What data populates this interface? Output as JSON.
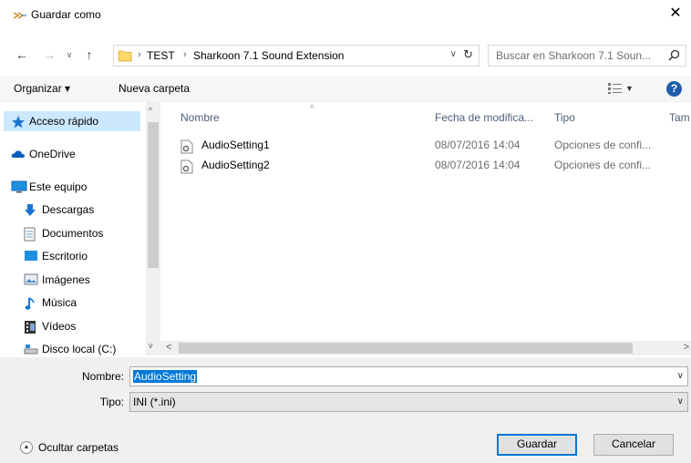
{
  "window": {
    "title": "Guardar como",
    "close_glyph": "✕"
  },
  "nav": {
    "back": "←",
    "forward": "→",
    "recent": "∨",
    "up": "↑",
    "breadcrumb": [
      "TEST",
      "Sharkoon 7.1 Sound Extension"
    ],
    "crumb_sep": "›",
    "address_drop": "∨",
    "refresh": "↻"
  },
  "search": {
    "placeholder": "Buscar en Sharkoon 7.1 Soun..."
  },
  "toolbar": {
    "organize": "Organizar ▾",
    "new_folder": "Nueva carpeta",
    "view_drop": "▼",
    "help": "?"
  },
  "sidebar": {
    "items": [
      {
        "label": "Acceso rápido",
        "icon": "star-icon"
      },
      {
        "label": "OneDrive",
        "icon": "cloud-icon"
      },
      {
        "label": "Este equipo",
        "icon": "computer-icon"
      },
      {
        "label": "Descargas",
        "icon": "download-icon"
      },
      {
        "label": "Documentos",
        "icon": "document-icon"
      },
      {
        "label": "Escritorio",
        "icon": "desktop-icon"
      },
      {
        "label": "Imágenes",
        "icon": "image-icon"
      },
      {
        "label": "Música",
        "icon": "music-icon"
      },
      {
        "label": "Vídeos",
        "icon": "video-icon"
      },
      {
        "label": "Disco local (C:)",
        "icon": "drive-icon"
      }
    ]
  },
  "columns": {
    "name": "Nombre",
    "date": "Fecha de modifica...",
    "type": "Tipo",
    "size": "Tam",
    "sort_glyph": "^"
  },
  "files": [
    {
      "name": "AudioSetting1",
      "date": "08/07/2016 14:04",
      "type": "Opciones de confi..."
    },
    {
      "name": "AudioSetting2",
      "date": "08/07/2016 14:04",
      "type": "Opciones de confi..."
    }
  ],
  "scroll": {
    "up": "^",
    "down": "v",
    "left": "<",
    "right": ">"
  },
  "form": {
    "name_label": "Nombre:",
    "name_value": "AudioSetting",
    "type_label": "Tipo:",
    "type_value": "INI (*.ini)",
    "drop": "∨"
  },
  "footer": {
    "hide_folders": "Ocultar carpetas",
    "hide_glyph": "▲",
    "save": "Guardar",
    "cancel": "Cancelar"
  },
  "colors": {
    "accent": "#0078d7",
    "selected_bg": "#cce8ff",
    "folder": "#ffd966"
  }
}
